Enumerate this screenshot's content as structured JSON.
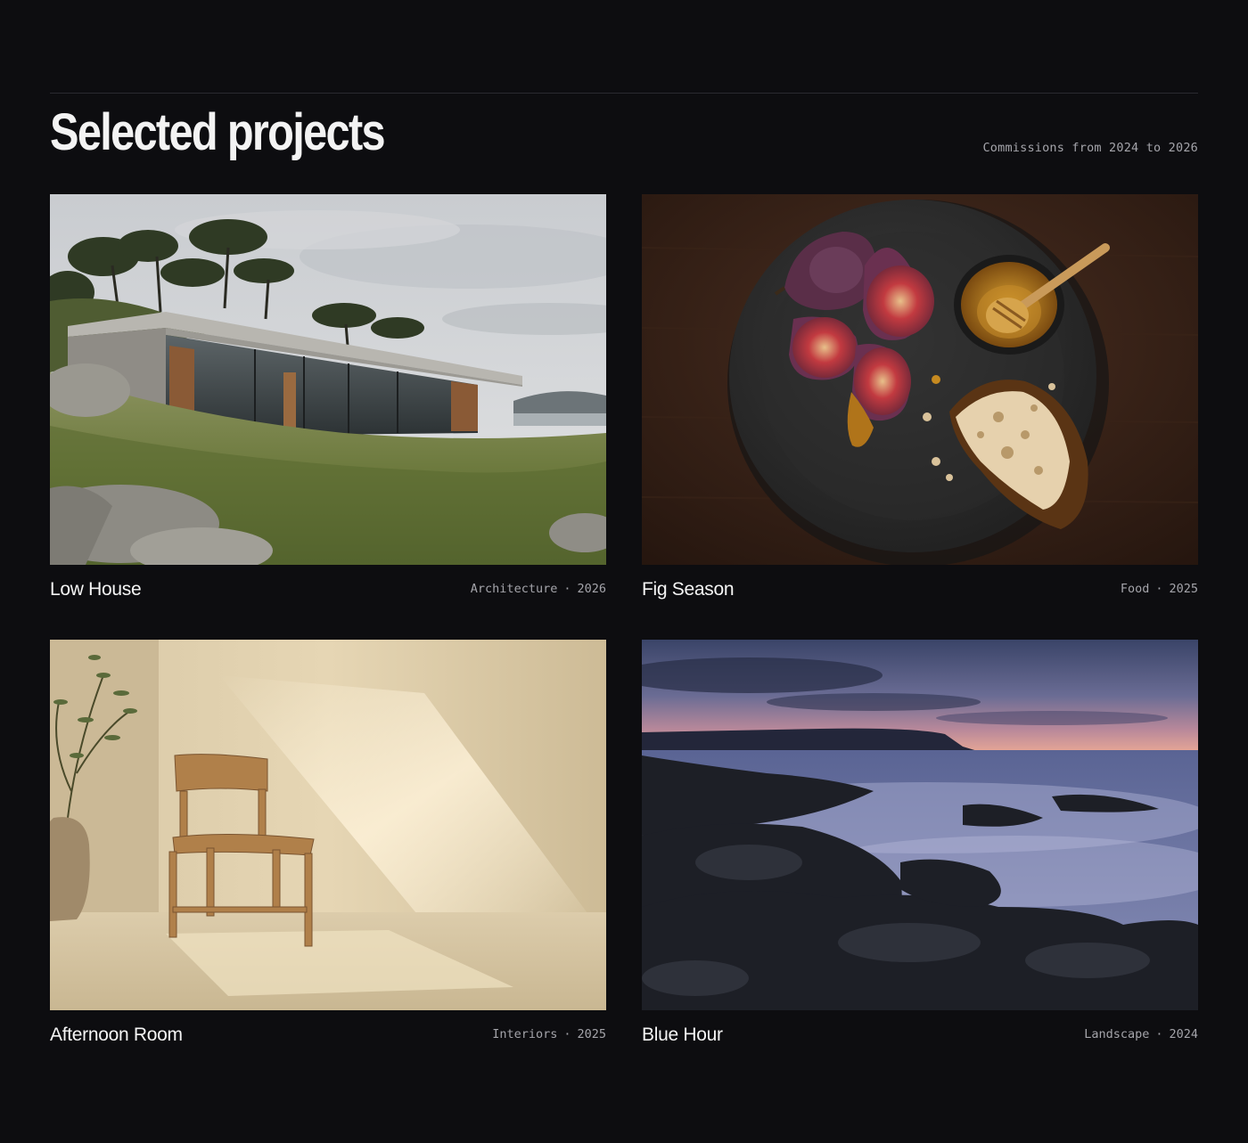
{
  "header": {
    "title": "Selected projects",
    "subtitle": "Commissions from 2024 to 2026"
  },
  "projects": [
    {
      "title": "Low House",
      "category": "Architecture",
      "separator": "·",
      "year": "2026",
      "photo": "modern-concrete-house-on-grassy-hillside"
    },
    {
      "title": "Fig Season",
      "category": "Food",
      "separator": "·",
      "year": "2025",
      "photo": "figs-honey-bread-on-dark-plate"
    },
    {
      "title": "Afternoon Room",
      "category": "Interiors",
      "separator": "·",
      "year": "2025",
      "photo": "wooden-chair-in-sunlit-room"
    },
    {
      "title": "Blue Hour",
      "category": "Landscape",
      "separator": "·",
      "year": "2024",
      "photo": "rocky-coast-at-dusk"
    }
  ],
  "colors": {
    "background": "#0d0d10",
    "text": "#f4f4f4",
    "muted": "#a4a4aa",
    "rule": "#2a2a30"
  }
}
